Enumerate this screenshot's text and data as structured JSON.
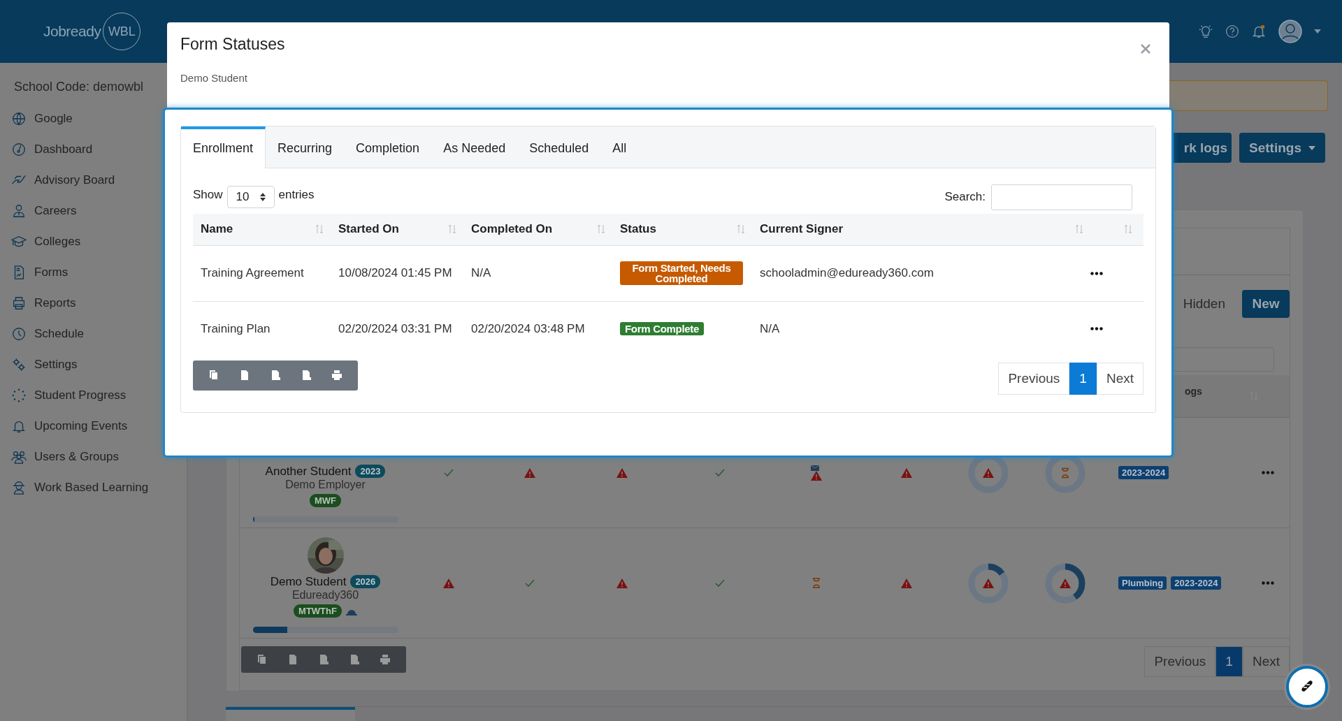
{
  "header": {
    "logo": {
      "text": "Jobready",
      "badge": "WBL"
    }
  },
  "sidebar": {
    "school_code": "School Code: demowbl",
    "items": [
      {
        "label": "Google"
      },
      {
        "label": "Dashboard"
      },
      {
        "label": "Advisory Board"
      },
      {
        "label": "Careers"
      },
      {
        "label": "Colleges"
      },
      {
        "label": "Forms"
      },
      {
        "label": "Reports"
      },
      {
        "label": "Schedule"
      },
      {
        "label": "Settings"
      },
      {
        "label": "Student Progress"
      },
      {
        "label": "Upcoming Events"
      },
      {
        "label": "Users & Groups"
      },
      {
        "label": "Work Based Learning"
      }
    ]
  },
  "background": {
    "buttons": [
      {
        "label": "rk logs",
        "kind": "plain"
      },
      {
        "label": "Settings",
        "kind": "dropdown"
      }
    ],
    "hidden_label": "Hidden",
    "new_button": "New",
    "column_10": "ogs",
    "rows": [
      {
        "name": "Another Student",
        "year": "2023",
        "employer": "Demo Employer",
        "days": "MWF",
        "safety_icon": false,
        "avatar_visible": false,
        "level": 0.01,
        "statuses": [
          {
            "kind": "check"
          },
          {
            "kind": "alert"
          },
          {
            "kind": "alert"
          },
          {
            "kind": "check"
          },
          {
            "kind": "alert_mail"
          },
          {
            "kind": "alert"
          }
        ],
        "donuts": [
          {
            "kind": "alert"
          },
          {
            "kind": "hourglass"
          }
        ],
        "tags": [
          "2023-2024"
        ]
      },
      {
        "name": "Demo Student",
        "year": "2026",
        "employer": "Eduready360",
        "days": "MTWThF",
        "safety_icon": true,
        "avatar_visible": true,
        "level": 0.24,
        "statuses": [
          {
            "kind": "alert"
          },
          {
            "kind": "check"
          },
          {
            "kind": "alert"
          },
          {
            "kind": "check"
          },
          {
            "kind": "hourglass"
          },
          {
            "kind": "alert"
          }
        ],
        "donuts": [
          {
            "level": 0.15,
            "kind": "alert"
          },
          {
            "level": 0.4,
            "kind": "alert"
          }
        ],
        "tags": [
          "Plumbing",
          "2023-2024"
        ]
      }
    ],
    "pagination": [
      {
        "label": "Previous",
        "selected": false
      },
      {
        "label": "1",
        "selected": true
      },
      {
        "label": "Next",
        "selected": false
      }
    ]
  },
  "modal": {
    "title": "Form Statuses",
    "subtitle": "Demo Student",
    "tabs": [
      {
        "label": "Enrollment",
        "selected": true
      },
      {
        "label": "Recurring",
        "selected": false
      },
      {
        "label": "Completion",
        "selected": false
      },
      {
        "label": "As Needed",
        "selected": false
      },
      {
        "label": "Scheduled",
        "selected": false
      },
      {
        "label": "All",
        "selected": false
      }
    ],
    "length": {
      "before": "Show",
      "value": "10",
      "after": "entries"
    },
    "search": {
      "label": "Search:"
    },
    "table": {
      "columns": [
        "Name",
        "Started On",
        "Completed On",
        "Status",
        "Current Signer"
      ],
      "rows": [
        {
          "name": "Training Agreement",
          "started": "10/08/2024 01:45 PM",
          "completed": "N/A",
          "status": {
            "text": "Form Started, Needs Completed",
            "kind": "pending"
          },
          "signer": "schooladmin@eduready360.com"
        },
        {
          "name": "Training Plan",
          "started": "02/20/2024 03:31 PM",
          "completed": "02/20/2024 03:48 PM",
          "status": {
            "text": "Form Complete",
            "kind": "complete"
          },
          "signer": "N/A"
        }
      ]
    },
    "pagination": [
      {
        "label": "Previous",
        "selected": false
      },
      {
        "label": "1",
        "selected": true
      },
      {
        "label": "Next",
        "selected": false
      }
    ]
  }
}
